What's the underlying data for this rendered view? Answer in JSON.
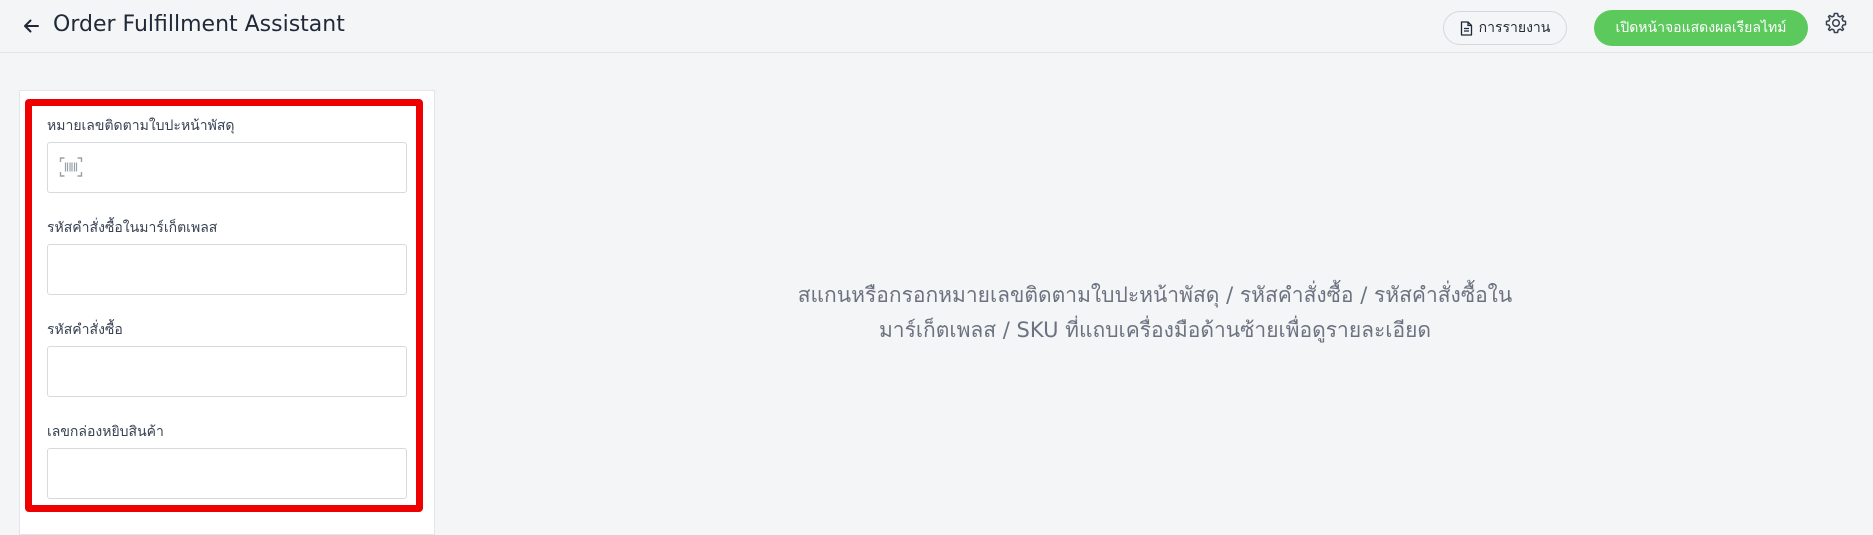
{
  "header": {
    "title": "Order Fulfillment Assistant",
    "back_icon": "arrow-left-icon",
    "report_button": {
      "label": "การรายงาน",
      "icon": "document-icon"
    },
    "live_button": {
      "label": "เปิดหน้าจอแสดงผลเรียลไทม์",
      "color": "#5bc95c"
    },
    "settings_icon": "gear-icon"
  },
  "form": {
    "fields": [
      {
        "label": "หมายเลขติดตามใบปะหน้าพัสดุ",
        "value": "",
        "icon": "barcode-scan-icon"
      },
      {
        "label": "รหัสคำสั่งซื้อในมาร์เก็ตเพลส",
        "value": ""
      },
      {
        "label": "รหัสคำสั่งซื้อ",
        "value": ""
      },
      {
        "label": "เลขกล่องหยิบสินค้า",
        "value": ""
      }
    ],
    "highlight_color": "#ee0000"
  },
  "main": {
    "empty_line1": "สแกนหรือกรอกหมายเลขติดตามใบปะหน้าพัสดุ / รหัสคำสั่งซื้อ / รหัสคำสั่งซื้อใน",
    "empty_line2": "มาร์เก็ตเพลส / SKU ที่แถบเครื่องมือด้านซ้ายเพื่อดูรายละเอียด"
  }
}
